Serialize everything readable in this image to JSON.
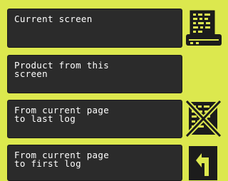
{
  "menu": {
    "options": [
      {
        "label": "Current screen",
        "icon": "printer-icon"
      },
      {
        "label": "Product from this\nscreen",
        "icon": ""
      },
      {
        "label": "From current page\nto last log",
        "icon": "no-log-icon"
      },
      {
        "label": "From current page\nto first log",
        "icon": "back-arrow-icon"
      }
    ]
  },
  "colors": {
    "background": "#dce84e",
    "button": "#2b2b2b",
    "text": "#ffffff"
  }
}
